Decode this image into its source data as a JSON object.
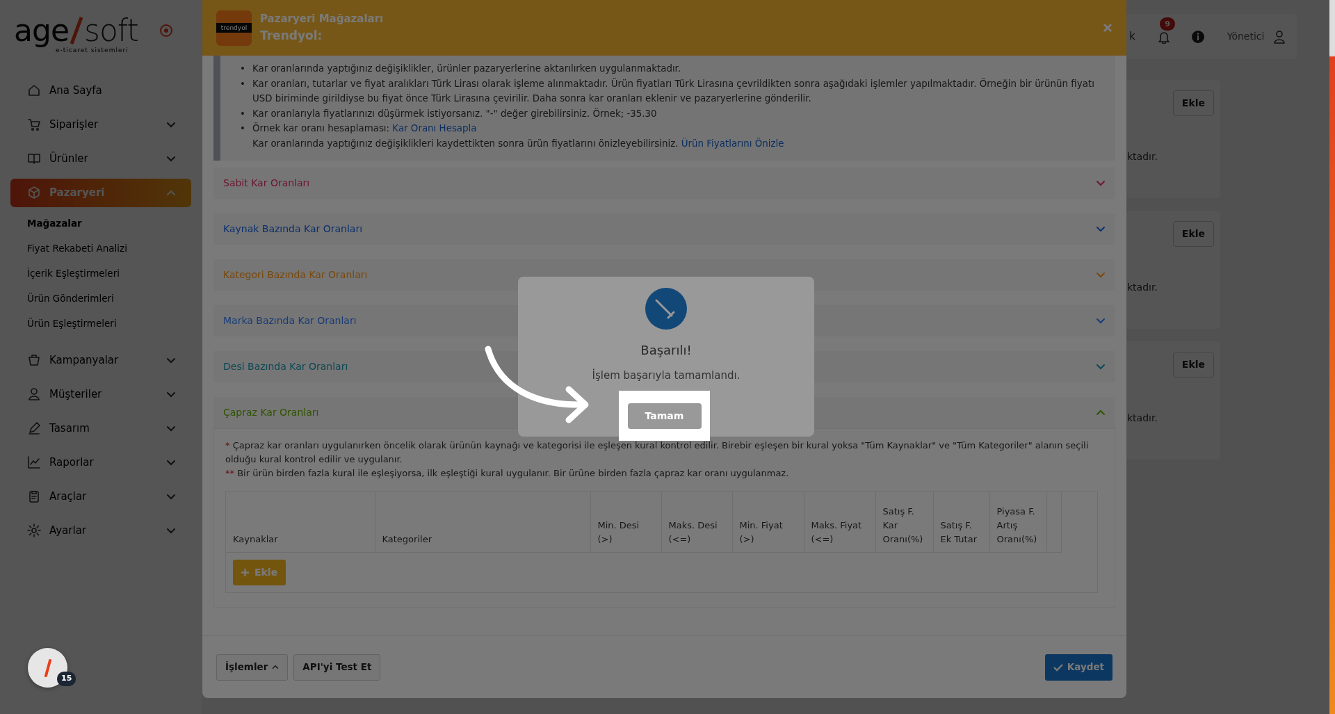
{
  "sidebar": {
    "logo": {
      "left": "age",
      "right": "soft",
      "tagline": "e-ticaret sistemleri"
    },
    "items": [
      {
        "label": "Ana Sayfa",
        "kind": "link",
        "selected": false
      },
      {
        "label": "Siparişler",
        "kind": "group",
        "selected": false,
        "expanded": false
      },
      {
        "label": "Ürünler",
        "kind": "group",
        "selected": false,
        "expanded": false
      },
      {
        "label": "Pazaryeri",
        "kind": "group",
        "selected": true,
        "expanded": true,
        "children": [
          {
            "label": "Mağazalar",
            "selected": true
          },
          {
            "label": "Fiyat Rekabeti Analizi",
            "selected": false
          },
          {
            "label": "İçerik Eşleştirmeleri",
            "selected": false
          },
          {
            "label": "Ürün Gönderimleri",
            "selected": false
          },
          {
            "label": "Ürün Eşleştirmeleri",
            "selected": false
          }
        ]
      },
      {
        "label": "Kampanyalar",
        "kind": "group",
        "selected": false,
        "expanded": false
      },
      {
        "label": "Müşteriler",
        "kind": "group",
        "selected": false,
        "expanded": false
      },
      {
        "label": "Tasarım",
        "kind": "group",
        "selected": false,
        "expanded": false
      },
      {
        "label": "Raporlar",
        "kind": "group",
        "selected": false,
        "expanded": false
      },
      {
        "label": "Araçlar",
        "kind": "group",
        "selected": false,
        "expanded": false
      },
      {
        "label": "Ayarlar",
        "kind": "group",
        "selected": false,
        "expanded": false
      }
    ],
    "chat_badge": "15"
  },
  "topbar": {
    "cut_text": "k",
    "notification_count": "9",
    "user": "Yönetici"
  },
  "background_cards": [
    {
      "button": "Ekle",
      "text": "ktadır."
    },
    {
      "button": "Ekle",
      "text": "ktadır."
    },
    {
      "button": "Ekle",
      "text": "ktadır."
    }
  ],
  "modal": {
    "brand_logo": "trendyol",
    "title": "Pazaryeri Mağazaları",
    "subtitle": "Trendyol:",
    "info": [
      {
        "bullet": "•",
        "lines": [
          {
            "text": "Kar oranlarında yaptığınız değişiklikler, ürünler pazaryerlerine aktarılırken uygulanmaktadır."
          }
        ]
      },
      {
        "bullet": "•",
        "lines": [
          {
            "text": "Kar oranları, tutarlar ve fiyat aralıkları Türk Lirası olarak işleme alınmaktadır. Ürün fiyatları Türk Lirasına çevrildikten sonra aşağıdaki işlemler yapılmaktadır. Örneğin bir ürünün fiyatı USD biriminde girildiyse bu fiyat önce Türk Lirasına çevirilir. Daha sonra kar oranları eklenir ve pazaryerlerine gönderilir."
          }
        ]
      },
      {
        "bullet": "•",
        "lines": [
          {
            "text": "Kar oranlarıyla fiyatlarınızı düşürmek istiyorsanız. \"-\" değer girebilirsiniz. Örnek; -35.30"
          }
        ]
      },
      {
        "bullet": "•",
        "lines": [
          {
            "text": "Örnek kar oranı hesaplaması:",
            "link": "Kar Oranı Hesapla"
          },
          {
            "text": "Kar oranlarında yaptığınız değişiklikleri kaydettikten sonra ürün fiyatlarını önizleyebilirsiniz.",
            "link": "Ürün Fiyatlarını Önizle"
          }
        ]
      }
    ],
    "accordions": [
      {
        "title": "Sabit Kar Oranları",
        "color": "#6c1830",
        "expanded": false
      },
      {
        "title": "Kaynak Bazında Kar Oranları",
        "color": "#0c306c",
        "expanded": false
      },
      {
        "title": "Kategori Bazında Kar Oranları",
        "color": "#78480c",
        "expanded": false
      },
      {
        "title": "Marka Bazında Kar Oranları",
        "color": "#183c78",
        "expanded": false
      },
      {
        "title": "Desi Bazında Kar Oranları",
        "color": "#0c4854",
        "expanded": false
      },
      {
        "title": "Çapraz Kar Oranları",
        "color": "#305400",
        "expanded": true
      }
    ],
    "cross": {
      "notes": [
        {
          "mark": "*",
          "text": "Çapraz kar oranları uygulanırken öncelik olarak ürünün kaynağı ve kategorisi ile eşleşen kural kontrol edilir. Birebir eşleşen bir kural yoksa \"Tüm Kaynaklar\" ve \"Tüm Kategoriler\" alanın seçili olduğu kural kontrol edilir ve uygulanır."
        },
        {
          "mark": "**",
          "text": "Bir ürün birden fazla kural ile eşleşiyorsa, ilk eşleştiği kural uygulanır. Bir ürüne birden fazla çapraz kar oranı uygulanmaz."
        }
      ],
      "columns": [
        "Kaynaklar",
        "Kategoriler",
        "Min. Desi (>)",
        "Maks. Desi (<=)",
        "Min. Fiyat (>)",
        "Maks. Fiyat (<=)",
        "Satış F. Kar Oranı(%)",
        "Satış F. Ek Tutar",
        "Piyasa F. Artış Oranı(%)"
      ],
      "add_button": "Ekle"
    },
    "footer": {
      "actions": "İşlemler",
      "test": "API'yi Test Et",
      "save": "Kaydet"
    }
  },
  "dialog": {
    "title": "Başarılı!",
    "message": "İşlem başarıyla tamamlandı.",
    "button": "Tamam"
  }
}
